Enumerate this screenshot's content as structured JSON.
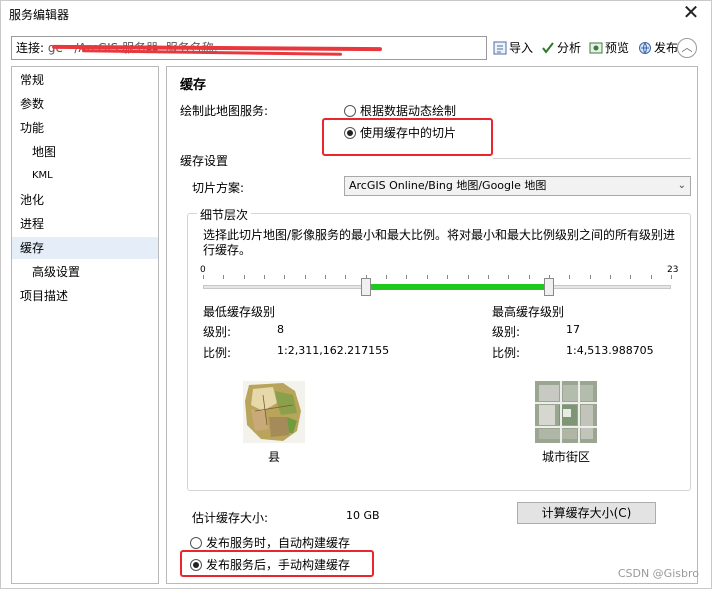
{
  "window": {
    "title": "服务编辑器",
    "close_glyph": "✕"
  },
  "toolbar": {
    "connection_label": "连接:",
    "connection_value": "ge···/ArcGIS 服务器, 服务名称, ···",
    "import_label": "导入",
    "analyze_label": "分析",
    "preview_label": "预览",
    "publish_label": "发布",
    "collapse_glyph": "︿"
  },
  "sidebar": {
    "items": [
      {
        "label": "常规"
      },
      {
        "label": "参数"
      },
      {
        "label": "功能"
      },
      {
        "label": "地图"
      },
      {
        "label": "KML"
      },
      {
        "label": "池化"
      },
      {
        "label": "进程"
      },
      {
        "label": "缓存"
      },
      {
        "label": "高级设置"
      },
      {
        "label": "项目描述"
      }
    ],
    "active": "缓存"
  },
  "cache": {
    "title": "缓存",
    "draw_label": "绘制此地图服务:",
    "draw_options": [
      {
        "label": "根据数据动态绘制",
        "checked": false
      },
      {
        "label": "使用缓存中的切片",
        "checked": true
      }
    ],
    "settings_label": "缓存设置",
    "tiling_scheme_label": "切片方案:",
    "tiling_scheme_value": "ArcGIS Online/Bing 地图/Google 地图",
    "detail_levels_title": "细节层次",
    "detail_levels_desc": "选择此切片地图/影像服务的最小和最大比例。将对最小和最大比例级别之间的所有级别进行缓存。",
    "slider": {
      "min": "0",
      "max": "23",
      "min_value": 8,
      "max_value": 17,
      "total": 23,
      "fill_color": "#1fc81f"
    },
    "min_level": {
      "title": "最低缓存级别",
      "level_label": "级别:",
      "level_value": "8",
      "scale_label": "比例:",
      "scale_value": "1:2,311,162.217155",
      "thumb_caption": "县"
    },
    "max_level": {
      "title": "最高缓存级别",
      "level_label": "级别:",
      "level_value": "17",
      "scale_label": "比例:",
      "scale_value": "1:4,513.988705",
      "thumb_caption": "城市街区"
    },
    "estimated_size_label": "估计缓存大小:",
    "estimated_size_value": "10 GB",
    "calc_button_label": "计算缓存大小(C)",
    "build_options": [
      {
        "label": "发布服务时，自动构建缓存",
        "checked": false
      },
      {
        "label": "发布服务后，手动构建缓存",
        "checked": true
      }
    ],
    "highlight_color": "#e8262c"
  },
  "watermark": "CSDN @Gisbro"
}
